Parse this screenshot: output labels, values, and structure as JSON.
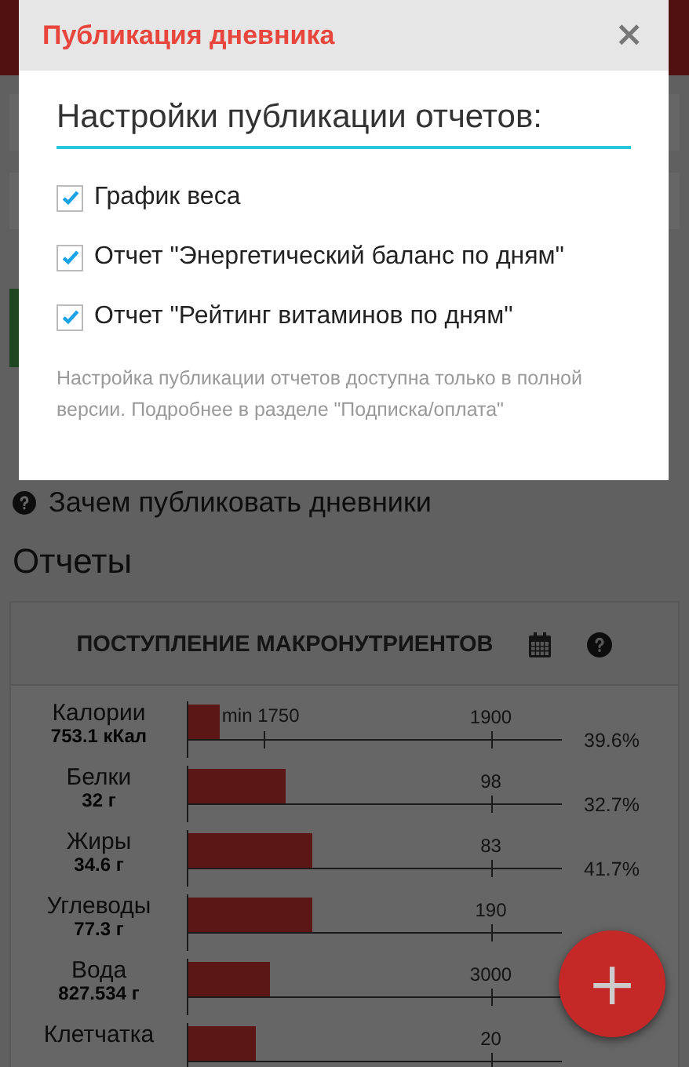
{
  "dialog": {
    "title": "Публикация дневника",
    "close": "×",
    "heading": "Настройки публикации отчетов:",
    "options": [
      {
        "label": "График веса",
        "checked": true
      },
      {
        "label": "Отчет \"Энергетический баланс по дням\"",
        "checked": true
      },
      {
        "label": "Отчет \"Рейтинг витаминов по дням\"",
        "checked": true
      }
    ],
    "note": "Настройка публикации отчетов доступна только в полной версии. Подробнее в разделе \"Подписка/оплата\""
  },
  "page": {
    "help_link": "Зачем публиковать дневники",
    "section_title": "Отчеты",
    "card": {
      "title": "ПОСТУПЛЕНИЕ МАКРОНУТРИЕНТОВ",
      "rows": [
        {
          "name": "Калории",
          "amount": "753.1 кКал",
          "level": 0.085,
          "min_label": "min 1750",
          "target": "1900",
          "percent": "39.6%"
        },
        {
          "name": "Белки",
          "amount": "32 г",
          "level": 0.26,
          "target": "98",
          "percent": "32.7%"
        },
        {
          "name": "Жиры",
          "amount": "34.6 г",
          "level": 0.33,
          "target": "83",
          "percent": "41.7%"
        },
        {
          "name": "Углеводы",
          "amount": "77.3 г",
          "level": 0.33,
          "target": "190"
        },
        {
          "name": "Вода",
          "amount": "827.534 г",
          "level": 0.22,
          "target": "3000"
        },
        {
          "name": "Клетчатка",
          "level": 0.18,
          "target": "20"
        }
      ]
    }
  },
  "fab": {
    "label": "+"
  }
}
